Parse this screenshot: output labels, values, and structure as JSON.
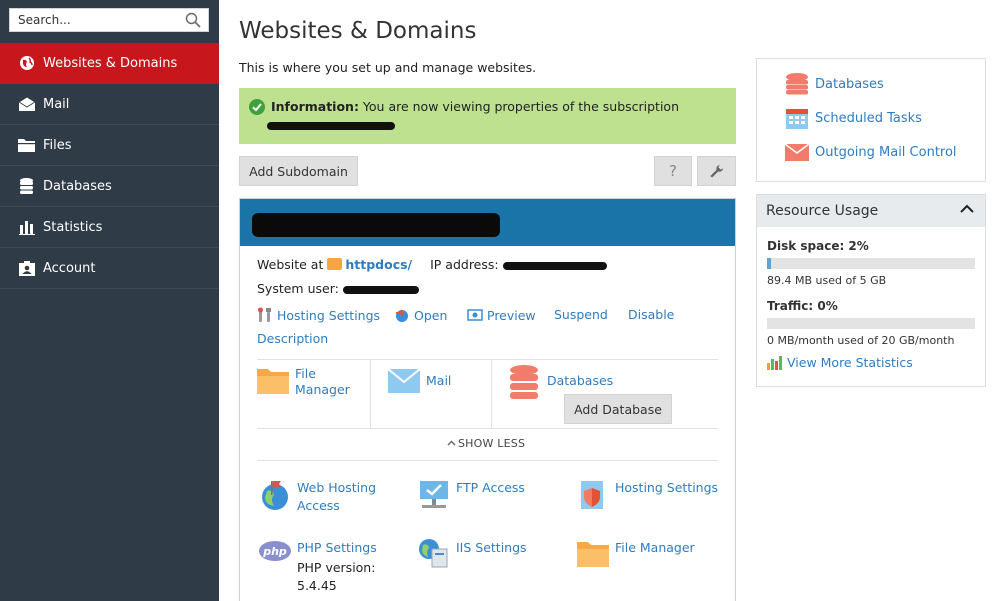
{
  "search": {
    "placeholder": "Search..."
  },
  "sidebar": {
    "items": [
      {
        "label": "Websites & Domains",
        "icon": "globe-icon",
        "active": true
      },
      {
        "label": "Mail",
        "icon": "mail-icon"
      },
      {
        "label": "Files",
        "icon": "files-icon"
      },
      {
        "label": "Databases",
        "icon": "database-icon"
      },
      {
        "label": "Statistics",
        "icon": "statistics-icon"
      },
      {
        "label": "Account",
        "icon": "account-icon"
      }
    ]
  },
  "main": {
    "title": "Websites & Domains",
    "description": "This is where you set up and manage websites.",
    "info": {
      "label": "Information:",
      "text": " You are now viewing properties of the subscription"
    },
    "add_subdomain": "Add Subdomain",
    "help_label": "?",
    "site": {
      "website_at": "Website at",
      "docroot": "httpdocs/",
      "ip_label": "IP address:",
      "system_user_label": "System user:",
      "actions": {
        "hosting_settings": "Hosting Settings",
        "open": "Open",
        "preview": "Preview",
        "suspend": "Suspend",
        "disable": "Disable",
        "description": "Description"
      },
      "tiles": {
        "file_manager": [
          "File",
          "Manager"
        ],
        "mail": "Mail",
        "databases": "Databases",
        "add_database": "Add Database"
      },
      "show_less": "SHOW LESS",
      "features": {
        "web_hosting_access": [
          "Web Hosting",
          "Access"
        ],
        "ftp_access": "FTP Access",
        "hosting_settings": "Hosting Settings",
        "php_settings": "PHP Settings",
        "php_version_label": "PHP version:",
        "php_version": "5.4.45",
        "iis_settings": "IIS Settings",
        "file_manager": "File Manager"
      }
    }
  },
  "right": {
    "quick_links": [
      {
        "label": "Databases",
        "icon": "database-icon"
      },
      {
        "label": "Scheduled Tasks",
        "icon": "calendar-icon"
      },
      {
        "label": "Outgoing Mail Control",
        "icon": "envelope-icon"
      }
    ],
    "resource": {
      "title": "Resource Usage",
      "disk_label": "Disk space: 2%",
      "disk_fraction": 0.02,
      "disk_sub": "89.4 MB used of 5 GB",
      "traffic_label": "Traffic: 0%",
      "traffic_fraction": 0,
      "traffic_sub": "0 MB/month used of 20 GB/month",
      "more": "View More Statistics"
    }
  },
  "colors": {
    "accent_red": "#c8161d",
    "sidebar_bg": "#2f3b47",
    "link": "#2f7cc1",
    "info_bg": "#bde18f",
    "header_blue": "#1a74a8"
  }
}
